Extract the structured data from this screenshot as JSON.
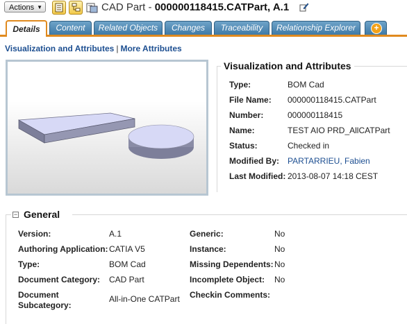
{
  "header": {
    "actions_label": "Actions",
    "object_type": "CAD Part",
    "object_name": "000000118415.CATPart, A.1"
  },
  "tabs": [
    {
      "label": "Details",
      "active": true
    },
    {
      "label": "Content"
    },
    {
      "label": "Related Objects"
    },
    {
      "label": "Changes"
    },
    {
      "label": "Traceability"
    },
    {
      "label": "Relationship Explorer"
    }
  ],
  "links": {
    "visualization": "Visualization and Attributes",
    "separator": "|",
    "more": "More Attributes"
  },
  "attributes": {
    "title": "Visualization and Attributes",
    "rows": [
      {
        "label": "Type:",
        "value": "BOM Cad"
      },
      {
        "label": "File Name:",
        "value": "000000118415.CATPart"
      },
      {
        "label": "Number:",
        "value": "000000118415"
      },
      {
        "label": "Name:",
        "value": "TEST AIO PRD_AllCATPart"
      },
      {
        "label": "Status:",
        "value": "Checked in"
      },
      {
        "label": "Modified By:",
        "value": "PARTARRIEU, Fabien"
      },
      {
        "label": "Last Modified:",
        "value": "2013-08-07 14:18 CEST"
      }
    ]
  },
  "general": {
    "title": "General",
    "collapse_symbol": "⊟",
    "left": [
      {
        "label": "Version:",
        "value": "A.1"
      },
      {
        "label": "Authoring Application:",
        "value": "CATIA V5"
      },
      {
        "label": "Type:",
        "value": "BOM Cad"
      },
      {
        "label": "Document Category:",
        "value": "CAD Part"
      },
      {
        "label_line1": "Document",
        "label_line2": "Subcategory:",
        "value": "All-in-One CATPart"
      }
    ],
    "right": [
      {
        "label": "Generic:",
        "value": "No"
      },
      {
        "label": "Instance:",
        "value": "No"
      },
      {
        "label": "Missing Dependents:",
        "value": "No"
      },
      {
        "label": "Incomplete Object:",
        "value": "No"
      },
      {
        "label": "Checkin Comments:",
        "value": ""
      }
    ]
  },
  "colors": {
    "tab_blue": "#4f89b5",
    "active_tab_border": "#e08a1e",
    "link_blue": "#1d4f91"
  },
  "icons": [
    "chevron-down-icon",
    "info-page-icon",
    "structure-icon",
    "cad-part-icon",
    "edit-pencil-icon",
    "add-tab-icon",
    "collapse-icon"
  ]
}
